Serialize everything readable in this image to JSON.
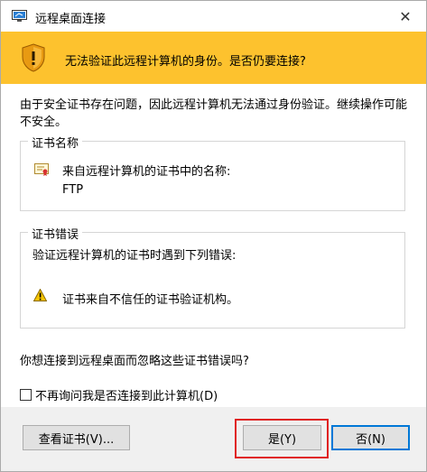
{
  "window": {
    "title": "远程桌面连接",
    "close_glyph": "✕"
  },
  "banner": {
    "text": "无法验证此远程计算机的身份。是否仍要连接?"
  },
  "content": {
    "description": "由于安全证书存在问题，因此远程计算机无法通过身份验证。继续操作可能不安全。",
    "cert_name_group": {
      "title": "证书名称",
      "label": "来自远程计算机的证书中的名称:",
      "value": "FTP"
    },
    "cert_error_group": {
      "title": "证书错误",
      "label": "验证远程计算机的证书时遇到下列错误:",
      "error": "证书来自不信任的证书验证机构。"
    },
    "question": "你想连接到远程桌面而忽略这些证书错误吗?",
    "checkbox_label": "不再询问我是否连接到此计算机(D)"
  },
  "buttons": {
    "view_cert": "查看证书(V)...",
    "yes": "是(Y)",
    "no": "否(N)"
  },
  "colors": {
    "banner": "#fdc22e",
    "default_button_border": "#0078d7",
    "highlight": "#e02020"
  }
}
